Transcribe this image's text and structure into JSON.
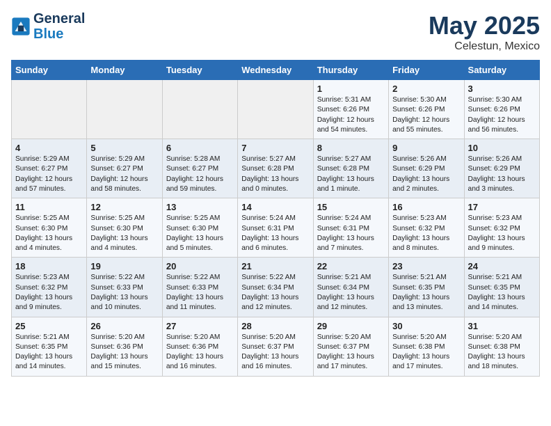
{
  "logo": {
    "line1": "General",
    "line2": "Blue"
  },
  "title": "May 2025",
  "subtitle": "Celestun, Mexico",
  "days_of_week": [
    "Sunday",
    "Monday",
    "Tuesday",
    "Wednesday",
    "Thursday",
    "Friday",
    "Saturday"
  ],
  "weeks": [
    [
      {
        "num": "",
        "info": ""
      },
      {
        "num": "",
        "info": ""
      },
      {
        "num": "",
        "info": ""
      },
      {
        "num": "",
        "info": ""
      },
      {
        "num": "1",
        "info": "Sunrise: 5:31 AM\nSunset: 6:26 PM\nDaylight: 12 hours\nand 54 minutes."
      },
      {
        "num": "2",
        "info": "Sunrise: 5:30 AM\nSunset: 6:26 PM\nDaylight: 12 hours\nand 55 minutes."
      },
      {
        "num": "3",
        "info": "Sunrise: 5:30 AM\nSunset: 6:26 PM\nDaylight: 12 hours\nand 56 minutes."
      }
    ],
    [
      {
        "num": "4",
        "info": "Sunrise: 5:29 AM\nSunset: 6:27 PM\nDaylight: 12 hours\nand 57 minutes."
      },
      {
        "num": "5",
        "info": "Sunrise: 5:29 AM\nSunset: 6:27 PM\nDaylight: 12 hours\nand 58 minutes."
      },
      {
        "num": "6",
        "info": "Sunrise: 5:28 AM\nSunset: 6:27 PM\nDaylight: 12 hours\nand 59 minutes."
      },
      {
        "num": "7",
        "info": "Sunrise: 5:27 AM\nSunset: 6:28 PM\nDaylight: 13 hours\nand 0 minutes."
      },
      {
        "num": "8",
        "info": "Sunrise: 5:27 AM\nSunset: 6:28 PM\nDaylight: 13 hours\nand 1 minute."
      },
      {
        "num": "9",
        "info": "Sunrise: 5:26 AM\nSunset: 6:29 PM\nDaylight: 13 hours\nand 2 minutes."
      },
      {
        "num": "10",
        "info": "Sunrise: 5:26 AM\nSunset: 6:29 PM\nDaylight: 13 hours\nand 3 minutes."
      }
    ],
    [
      {
        "num": "11",
        "info": "Sunrise: 5:25 AM\nSunset: 6:30 PM\nDaylight: 13 hours\nand 4 minutes."
      },
      {
        "num": "12",
        "info": "Sunrise: 5:25 AM\nSunset: 6:30 PM\nDaylight: 13 hours\nand 4 minutes."
      },
      {
        "num": "13",
        "info": "Sunrise: 5:25 AM\nSunset: 6:30 PM\nDaylight: 13 hours\nand 5 minutes."
      },
      {
        "num": "14",
        "info": "Sunrise: 5:24 AM\nSunset: 6:31 PM\nDaylight: 13 hours\nand 6 minutes."
      },
      {
        "num": "15",
        "info": "Sunrise: 5:24 AM\nSunset: 6:31 PM\nDaylight: 13 hours\nand 7 minutes."
      },
      {
        "num": "16",
        "info": "Sunrise: 5:23 AM\nSunset: 6:32 PM\nDaylight: 13 hours\nand 8 minutes."
      },
      {
        "num": "17",
        "info": "Sunrise: 5:23 AM\nSunset: 6:32 PM\nDaylight: 13 hours\nand 9 minutes."
      }
    ],
    [
      {
        "num": "18",
        "info": "Sunrise: 5:23 AM\nSunset: 6:32 PM\nDaylight: 13 hours\nand 9 minutes."
      },
      {
        "num": "19",
        "info": "Sunrise: 5:22 AM\nSunset: 6:33 PM\nDaylight: 13 hours\nand 10 minutes."
      },
      {
        "num": "20",
        "info": "Sunrise: 5:22 AM\nSunset: 6:33 PM\nDaylight: 13 hours\nand 11 minutes."
      },
      {
        "num": "21",
        "info": "Sunrise: 5:22 AM\nSunset: 6:34 PM\nDaylight: 13 hours\nand 12 minutes."
      },
      {
        "num": "22",
        "info": "Sunrise: 5:21 AM\nSunset: 6:34 PM\nDaylight: 13 hours\nand 12 minutes."
      },
      {
        "num": "23",
        "info": "Sunrise: 5:21 AM\nSunset: 6:35 PM\nDaylight: 13 hours\nand 13 minutes."
      },
      {
        "num": "24",
        "info": "Sunrise: 5:21 AM\nSunset: 6:35 PM\nDaylight: 13 hours\nand 14 minutes."
      }
    ],
    [
      {
        "num": "25",
        "info": "Sunrise: 5:21 AM\nSunset: 6:35 PM\nDaylight: 13 hours\nand 14 minutes."
      },
      {
        "num": "26",
        "info": "Sunrise: 5:20 AM\nSunset: 6:36 PM\nDaylight: 13 hours\nand 15 minutes."
      },
      {
        "num": "27",
        "info": "Sunrise: 5:20 AM\nSunset: 6:36 PM\nDaylight: 13 hours\nand 16 minutes."
      },
      {
        "num": "28",
        "info": "Sunrise: 5:20 AM\nSunset: 6:37 PM\nDaylight: 13 hours\nand 16 minutes."
      },
      {
        "num": "29",
        "info": "Sunrise: 5:20 AM\nSunset: 6:37 PM\nDaylight: 13 hours\nand 17 minutes."
      },
      {
        "num": "30",
        "info": "Sunrise: 5:20 AM\nSunset: 6:38 PM\nDaylight: 13 hours\nand 17 minutes."
      },
      {
        "num": "31",
        "info": "Sunrise: 5:20 AM\nSunset: 6:38 PM\nDaylight: 13 hours\nand 18 minutes."
      }
    ]
  ]
}
